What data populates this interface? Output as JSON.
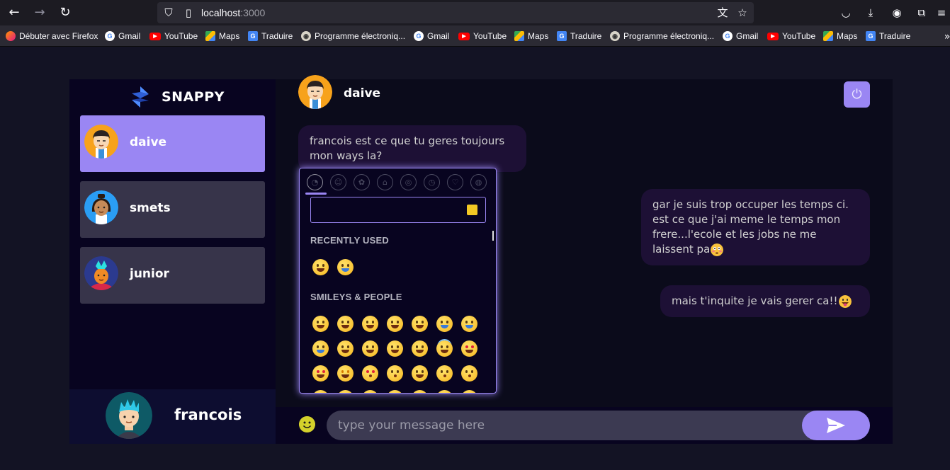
{
  "browser": {
    "url_host": "localhost",
    "url_port": ":3000",
    "bookmarks": [
      {
        "icon": "firefox-icon",
        "label": "Débuter avec Firefox"
      },
      {
        "icon": "google-icon",
        "label": "Gmail"
      },
      {
        "icon": "youtube-icon",
        "label": "YouTube"
      },
      {
        "icon": "maps-icon",
        "label": "Maps"
      },
      {
        "icon": "translate-icon",
        "label": "Traduire"
      },
      {
        "icon": "program-icon",
        "label": "Programme électroniq..."
      },
      {
        "icon": "google-icon",
        "label": "Gmail"
      },
      {
        "icon": "youtube-icon",
        "label": "YouTube"
      },
      {
        "icon": "maps-icon",
        "label": "Maps"
      },
      {
        "icon": "translate-icon",
        "label": "Traduire"
      },
      {
        "icon": "program-icon",
        "label": "Programme électroniq..."
      },
      {
        "icon": "google-icon",
        "label": "Gmail"
      },
      {
        "icon": "youtube-icon",
        "label": "YouTube"
      },
      {
        "icon": "maps-icon",
        "label": "Maps"
      },
      {
        "icon": "translate-icon",
        "label": "Traduire"
      }
    ]
  },
  "app": {
    "brand": "SNAPPY",
    "contacts": [
      {
        "name": "daive",
        "selected": true
      },
      {
        "name": "smets",
        "selected": false
      },
      {
        "name": "junior",
        "selected": false
      }
    ],
    "current_user": "francois"
  },
  "chat": {
    "header_name": "daive",
    "messages": [
      {
        "direction": "received",
        "text": "francois est ce que tu geres toujours mon ways la?"
      },
      {
        "direction": "sent",
        "text": "gar je suis trop occuper les temps ci. est ce que j'ai meme le temps mon frere...l'ecole et les jobs ne me laissent pa",
        "emoji": "flushed-face"
      },
      {
        "direction": "sent",
        "text": "mais t'inquite je vais gerer ca!!",
        "emoji": "tongue-face"
      }
    ],
    "input_placeholder": "type your message here"
  },
  "emoji_picker": {
    "sections": [
      {
        "title": "RECENTLY USED"
      },
      {
        "title": "SMILEYS & PEOPLE"
      }
    ]
  },
  "colors": {
    "accent": "#9a86f3",
    "background": "#131324",
    "sidebar": "#080420",
    "bubble": "#1d1035"
  }
}
